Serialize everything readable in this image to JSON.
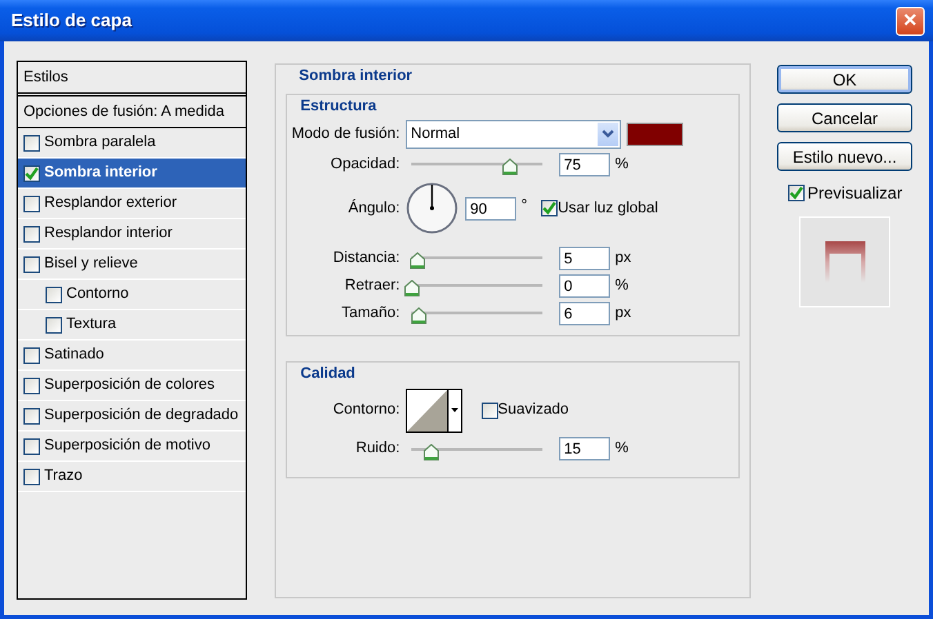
{
  "window": {
    "title": "Estilo de capa",
    "close": "✕"
  },
  "styles": {
    "header": "Estilos",
    "blend_options": "Opciones de fusión: A medida",
    "items": [
      {
        "label": "Sombra paralela",
        "checked": false,
        "selected": false
      },
      {
        "label": "Sombra interior",
        "checked": true,
        "selected": true
      },
      {
        "label": "Resplandor exterior",
        "checked": false,
        "selected": false
      },
      {
        "label": "Resplandor interior",
        "checked": false,
        "selected": false
      },
      {
        "label": "Bisel y relieve",
        "checked": false,
        "selected": false,
        "children": [
          {
            "label": "Contorno",
            "checked": false,
            "selected": false
          },
          {
            "label": "Textura",
            "checked": false,
            "selected": false
          }
        ]
      },
      {
        "label": "Satinado",
        "checked": false,
        "selected": false
      },
      {
        "label": "Superposición de colores",
        "checked": false,
        "selected": false
      },
      {
        "label": "Superposición de degradado",
        "checked": false,
        "selected": false
      },
      {
        "label": "Superposición de motivo",
        "checked": false,
        "selected": false
      },
      {
        "label": "Trazo",
        "checked": false,
        "selected": false
      }
    ]
  },
  "panel": {
    "title": "Sombra interior",
    "structure": {
      "title": "Estructura",
      "blend_mode": {
        "label": "Modo de fusión:",
        "value": "Normal",
        "color": "#800000"
      },
      "opacity": {
        "label": "Opacidad:",
        "level": 0.75,
        "value": "75",
        "unit": "%"
      },
      "angle": {
        "label": "Ángulo:",
        "value": "90",
        "unit": "°",
        "global_light": {
          "label": "Usar luz global",
          "checked": true
        }
      },
      "sliders": [
        {
          "label": "Distancia:",
          "level": 0.05,
          "value": "5",
          "unit": "px"
        },
        {
          "label": "Retraer:",
          "level": 0.0,
          "value": "0",
          "unit": "%"
        },
        {
          "label": "Tamaño:",
          "level": 0.06,
          "value": "6",
          "unit": "px"
        }
      ]
    },
    "quality": {
      "title": "Calidad",
      "contour": {
        "label": "Contorno:",
        "antialiased": {
          "label": "Suavizado",
          "checked": false
        }
      },
      "noise": {
        "label": "Ruido:",
        "level": 0.15,
        "value": "15",
        "unit": "%"
      }
    }
  },
  "buttons": [
    {
      "label": "OK",
      "default": true
    },
    {
      "label": "Cancelar",
      "default": false
    },
    {
      "label": "Estilo nuevo...",
      "default": false
    }
  ],
  "preview": {
    "label": "Previsualizar",
    "checked": true
  }
}
